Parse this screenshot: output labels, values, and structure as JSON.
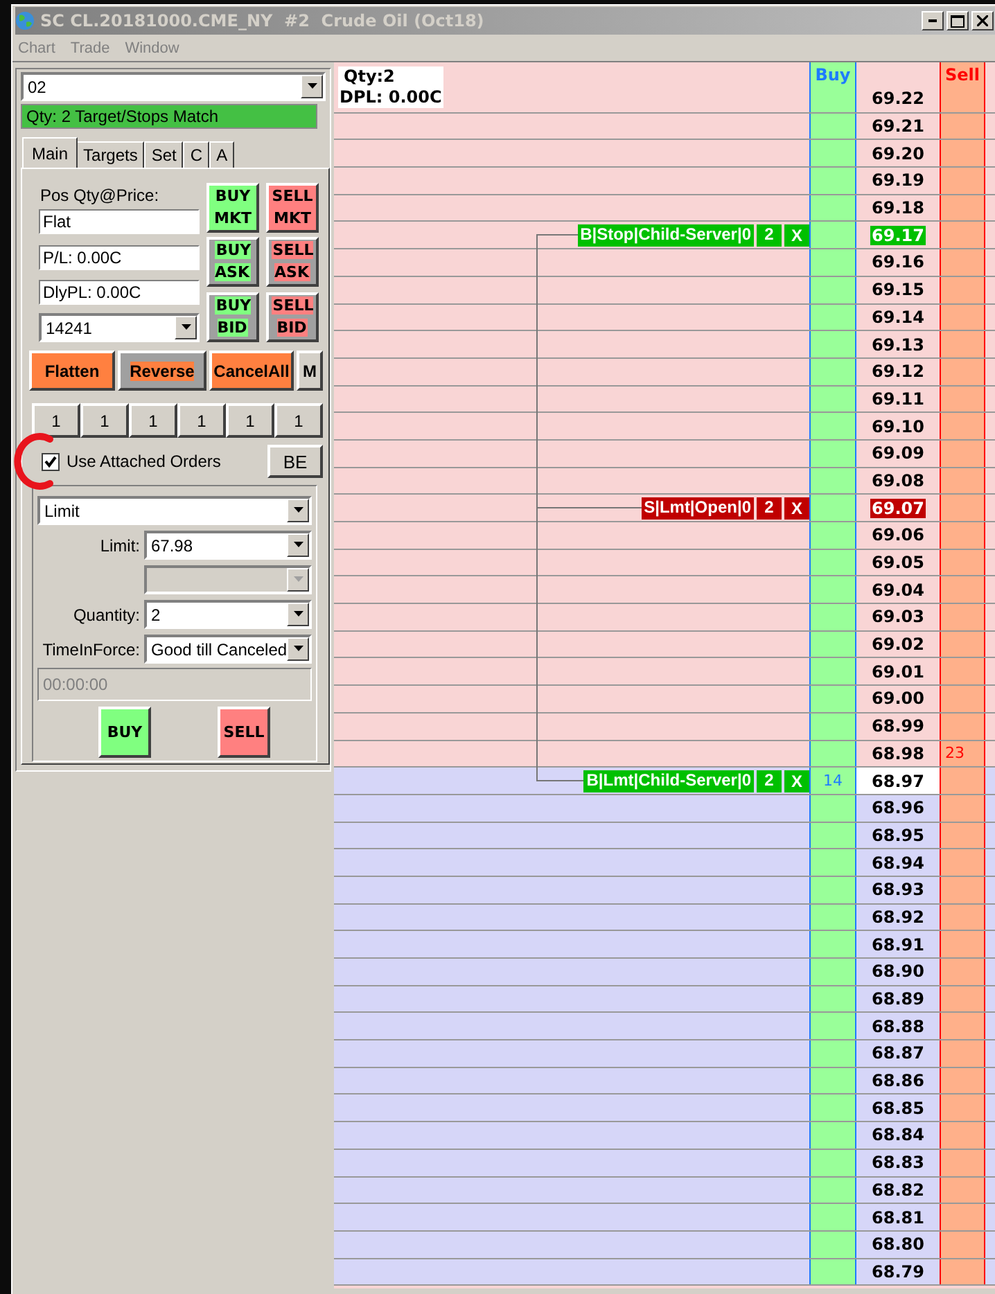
{
  "window": {
    "title": "SC CL.20181000.CME_NY  #2  Crude Oil (Oct18)"
  },
  "menu": [
    {
      "label": "Chart",
      "disabled": true
    },
    {
      "label": "Trade",
      "disabled": true
    },
    {
      "label": "Window",
      "disabled": true
    }
  ],
  "order_panel": {
    "account": "02",
    "status": "Qty: 2 Target/Stops Match",
    "tabs": [
      {
        "label": "Main",
        "selected": true
      },
      {
        "label": "Targets",
        "selected": false
      },
      {
        "label": "Set",
        "selected": false
      },
      {
        "label": "C",
        "selected": false
      },
      {
        "label": "A",
        "selected": false
      }
    ],
    "position_label": "Pos Qty@Price:",
    "position": "Flat",
    "pl": "P/L: 0.00C",
    "daily_pl": "DlyPL: 0.00C",
    "quantity_combo": "14241",
    "trade_buttons": [
      {
        "label": "BUY MKT",
        "color": "#80ff80",
        "kind": "market"
      },
      {
        "label": "SELL MKT",
        "color": "#ff8080",
        "kind": "market"
      },
      {
        "label": "BUY ASK",
        "color": "#80ff80",
        "kind": "price"
      },
      {
        "label": "SELL ASK",
        "color": "#ff8080",
        "kind": "price"
      },
      {
        "label": "BUY BID",
        "color": "#80ff80",
        "kind": "price"
      },
      {
        "label": "SELL BID",
        "color": "#ff8080",
        "kind": "price"
      }
    ],
    "actions": [
      {
        "label": "Flatten",
        "kind": "flatten"
      },
      {
        "label": "Reverse",
        "kind": "reverse"
      },
      {
        "label": "CancelAll",
        "kind": "cancel"
      },
      {
        "label": "M",
        "kind": "menu"
      }
    ],
    "quick_quantities": [
      "1",
      "1",
      "1",
      "1",
      "1",
      "1"
    ],
    "attached_orders": {
      "label": "Use Attached Orders",
      "checked": true
    },
    "be_button": "BE",
    "order_type": "Limit",
    "fields": [
      {
        "label": "Limit:",
        "value": "67.98",
        "disabled": false
      },
      {
        "disabled": true
      },
      {
        "label": "Quantity:",
        "value": "2",
        "disabled": false
      },
      {
        "label": "TimeInForce:",
        "value": "Good till Canceled",
        "disabled": false
      }
    ],
    "expire_time": {
      "value": "00:00:00",
      "disabled": true
    },
    "submit_buttons": [
      {
        "label": "BUY",
        "color": "#80ff80"
      },
      {
        "label": "SELL",
        "color": "#ff8080"
      }
    ]
  },
  "ladder": {
    "position": "Qty:2",
    "dpl": "DPL: 0.00C",
    "buy_header": "Buy",
    "sell_header": "Sell",
    "rows": [
      {
        "price": "69.22",
        "kind": "ask"
      },
      {
        "price": "69.21",
        "kind": "ask"
      },
      {
        "price": "69.20",
        "kind": "ask"
      },
      {
        "price": "69.19",
        "kind": "ask"
      },
      {
        "price": "69.18",
        "kind": "ask"
      },
      {
        "price": "69.17",
        "kind": "ask",
        "price_highlight": {
          "color": "#00c000"
        },
        "order": {
          "text": "B|Stop|Child-Server|0",
          "qty": "2",
          "cancel": "X",
          "color": "#00c000"
        }
      },
      {
        "price": "69.16",
        "kind": "ask"
      },
      {
        "price": "69.15",
        "kind": "ask"
      },
      {
        "price": "69.14",
        "kind": "ask"
      },
      {
        "price": "69.13",
        "kind": "ask"
      },
      {
        "price": "69.12",
        "kind": "ask"
      },
      {
        "price": "69.11",
        "kind": "ask"
      },
      {
        "price": "69.10",
        "kind": "ask"
      },
      {
        "price": "69.09",
        "kind": "ask"
      },
      {
        "price": "69.08",
        "kind": "ask"
      },
      {
        "price": "69.07",
        "kind": "ask",
        "price_highlight": {
          "color": "#c00000"
        },
        "order": {
          "text": "S|Lmt|Open|0",
          "qty": "2",
          "cancel": "X",
          "color": "#c00000"
        }
      },
      {
        "price": "69.06",
        "kind": "ask"
      },
      {
        "price": "69.05",
        "kind": "ask"
      },
      {
        "price": "69.04",
        "kind": "ask"
      },
      {
        "price": "69.03",
        "kind": "ask"
      },
      {
        "price": "69.02",
        "kind": "ask"
      },
      {
        "price": "69.01",
        "kind": "ask"
      },
      {
        "price": "69.00",
        "kind": "ask"
      },
      {
        "price": "68.99",
        "kind": "ask"
      },
      {
        "price": "68.98",
        "kind": "ask",
        "sell": "23"
      },
      {
        "price": "68.97",
        "kind": "bid",
        "current": true,
        "buy": "14",
        "order": {
          "text": "B|Lmt|Child-Server|0",
          "qty": "2",
          "cancel": "X",
          "color": "#00c000"
        }
      },
      {
        "price": "68.96",
        "kind": "bid"
      },
      {
        "price": "68.95",
        "kind": "bid"
      },
      {
        "price": "68.94",
        "kind": "bid"
      },
      {
        "price": "68.93",
        "kind": "bid"
      },
      {
        "price": "68.92",
        "kind": "bid"
      },
      {
        "price": "68.91",
        "kind": "bid"
      },
      {
        "price": "68.90",
        "kind": "bid"
      },
      {
        "price": "68.89",
        "kind": "bid"
      },
      {
        "price": "68.88",
        "kind": "bid"
      },
      {
        "price": "68.87",
        "kind": "bid"
      },
      {
        "price": "68.86",
        "kind": "bid"
      },
      {
        "price": "68.85",
        "kind": "bid"
      },
      {
        "price": "68.84",
        "kind": "bid"
      },
      {
        "price": "68.83",
        "kind": "bid"
      },
      {
        "price": "68.82",
        "kind": "bid"
      },
      {
        "price": "68.81",
        "kind": "bid"
      },
      {
        "price": "68.80",
        "kind": "bid"
      },
      {
        "price": "68.79",
        "kind": "bid"
      }
    ]
  }
}
